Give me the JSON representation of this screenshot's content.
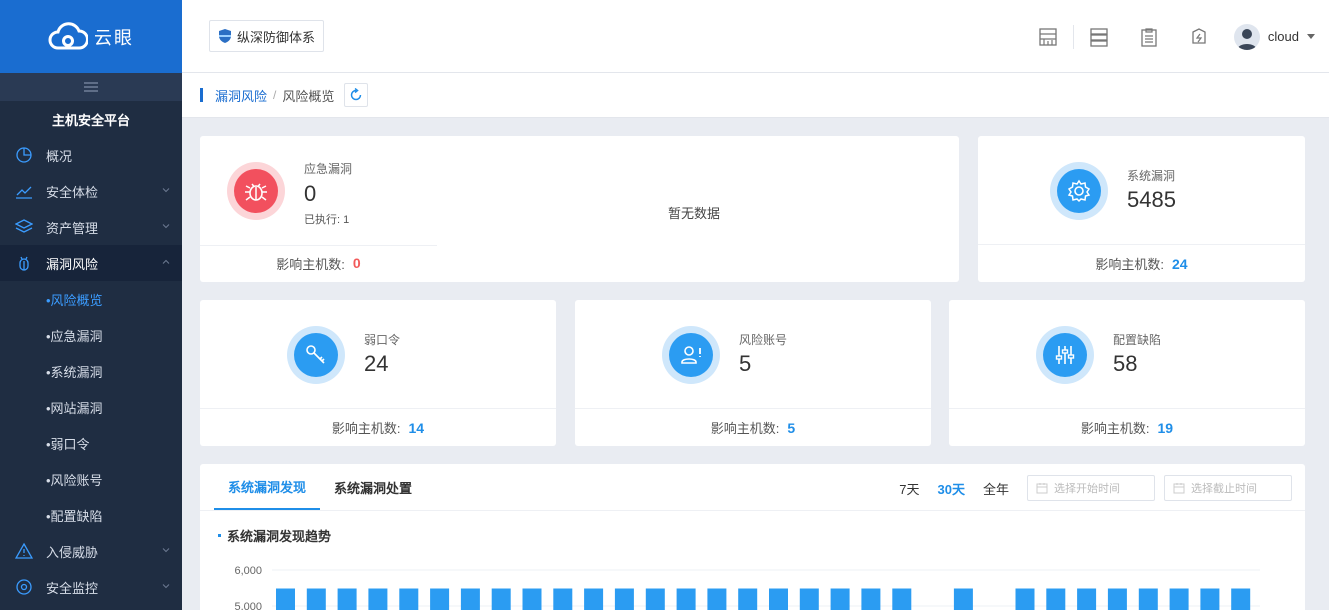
{
  "sidebar": {
    "logo_text": "云眼",
    "platform_title": "主机安全平台",
    "menu": [
      {
        "label": "概况",
        "icon": "pie-chart-icon"
      },
      {
        "label": "安全体检",
        "icon": "line-chart-icon"
      },
      {
        "label": "资产管理",
        "icon": "layers-icon"
      },
      {
        "label": "漏洞风险",
        "icon": "bug-icon"
      }
    ],
    "sub_menu": [
      "•风险概览",
      "•应急漏洞",
      "•系统漏洞",
      "•网站漏洞",
      "•弱口令",
      "•风险账号",
      "•配置缺陷"
    ],
    "menu_bottom": [
      {
        "label": "入侵威胁",
        "icon": "warning-icon"
      },
      {
        "label": "安全监控",
        "icon": "monitor-icon"
      }
    ]
  },
  "header": {
    "system_tag": "纵深防御体系",
    "username": "cloud"
  },
  "breadcrumb": {
    "parent": "漏洞风险",
    "separator": "/",
    "current": "风险概览"
  },
  "cards": {
    "emergency": {
      "label": "应急漏洞",
      "value": "0",
      "sub": "已执行: 1",
      "no_data": "暂无数据",
      "foot_label": "影响主机数:",
      "foot_value": "0"
    },
    "system": {
      "label": "系统漏洞",
      "value": "5485",
      "foot_label": "影响主机数:",
      "foot_value": "24"
    },
    "weak_pwd": {
      "label": "弱口令",
      "value": "24",
      "foot_label": "影响主机数:",
      "foot_value": "14"
    },
    "risk_account": {
      "label": "风险账号",
      "value": "5",
      "foot_label": "影响主机数:",
      "foot_value": "5"
    },
    "config": {
      "label": "配置缺陷",
      "value": "58",
      "foot_label": "影响主机数:",
      "foot_value": "19"
    }
  },
  "panel": {
    "tabs": [
      "系统漏洞发现",
      "系统漏洞处置"
    ],
    "ranges": [
      "7天",
      "30天",
      "全年"
    ],
    "active_range": "30天",
    "start_placeholder": "选择开始时间",
    "end_placeholder": "选择截止时间",
    "chart_title": "系统漏洞发现趋势"
  },
  "colors": {
    "accent": "#1f8ee8",
    "danger": "#f25a5a",
    "sidebar": "#1f2d42",
    "logo": "#1a6dd0"
  },
  "chart_data": {
    "type": "bar",
    "title": "系统漏洞发现趋势",
    "ylim": [
      0,
      6000
    ],
    "yticks": [
      "6,000",
      "5,000"
    ],
    "values": [
      5485,
      5485,
      5485,
      5485,
      5485,
      5485,
      5485,
      5485,
      5485,
      5485,
      5485,
      5485,
      5485,
      5485,
      5485,
      5485,
      5485,
      5485,
      5485,
      5485,
      5485,
      0,
      5485,
      0,
      5485,
      5485,
      5485,
      5485,
      5485,
      5485,
      5485,
      5485
    ],
    "series_color": "#2b9cf2"
  }
}
